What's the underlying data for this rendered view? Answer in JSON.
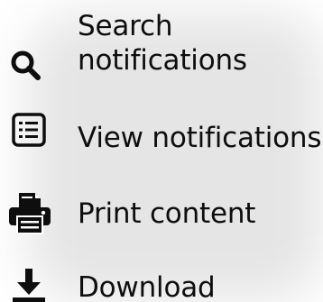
{
  "menu": {
    "items": [
      {
        "id": "search",
        "icon": "search-icon",
        "label_line1": "Search",
        "label_line2": "notifications"
      },
      {
        "id": "view",
        "icon": "list-icon",
        "label": "View notifications"
      },
      {
        "id": "print",
        "icon": "printer-icon",
        "label": "Print content"
      },
      {
        "id": "download",
        "icon": "download-icon",
        "label": "Download"
      }
    ]
  },
  "colors": {
    "text": "#0e0e0e",
    "background": "#ffffff"
  }
}
